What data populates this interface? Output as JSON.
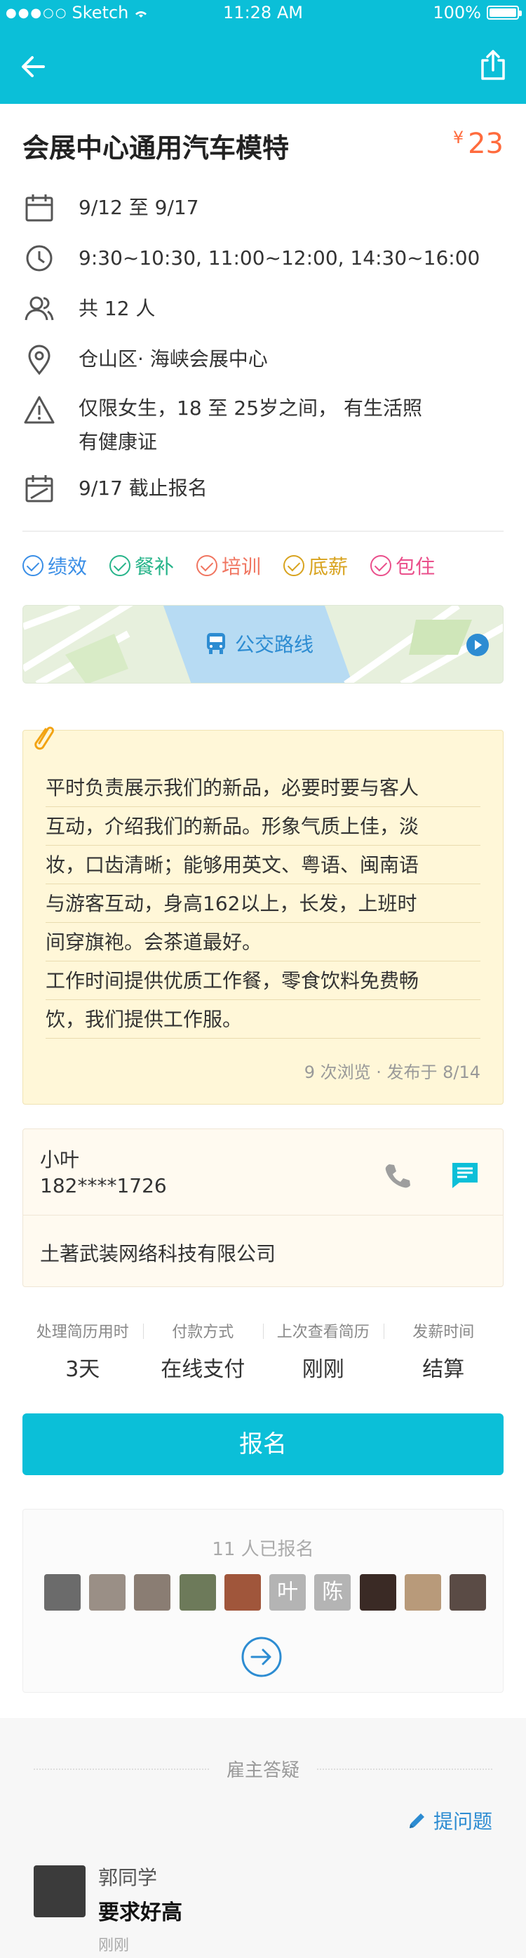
{
  "status_bar": {
    "carrier": "Sketch",
    "time": "11:28 AM",
    "battery": "100%"
  },
  "job": {
    "title": "会展中心通用汽车模特",
    "price_symbol": "¥",
    "price": "23"
  },
  "info": {
    "date": "9/12 至 9/17",
    "time": "9:30~10:30, 11:00~12:00, 14:30~16:00",
    "headcount": "共 12 人",
    "location": "仓山区· 海峡会展中心",
    "requirement_line1": "仅限女生，18 至 25岁之间， 有生活照",
    "requirement_line2": "有健康证",
    "deadline": "9/17 截止报名"
  },
  "tags": [
    {
      "label": "绩效",
      "color": "#3a8ee6"
    },
    {
      "label": "餐补",
      "color": "#27b48a"
    },
    {
      "label": "培训",
      "color": "#f07560"
    },
    {
      "label": "底薪",
      "color": "#d8a31f"
    },
    {
      "label": "包住",
      "color": "#ea4f8b"
    }
  ],
  "map": {
    "label": "公交路线"
  },
  "description": {
    "lines": [
      "平时负责展示我们的新品，必要时要与客人",
      "互动，介绍我们的新品。形象气质上佳，淡",
      "妆，口齿清晰；能够用英文、粤语、闽南语",
      "与游客互动，身高162以上，长发，上班时",
      "间穿旗袍。会茶道最好。",
      "工作时间提供优质工作餐，零食饮料免费畅",
      "饮，我们提供工作服。"
    ],
    "meta": "9 次浏览 · 发布于 8/14"
  },
  "contact": {
    "name": "小叶",
    "phone": "182****1726",
    "company": "土著武装网络科技有限公司"
  },
  "stats": [
    {
      "label": "处理简历用时",
      "value": "3天"
    },
    {
      "label": "付款方式",
      "value": "在线支付"
    },
    {
      "label": "上次查看简历",
      "value": "刚刚"
    },
    {
      "label": "发薪时间",
      "value": "结算"
    }
  ],
  "apply_label": "报名",
  "applicants": {
    "count": "11 人已报名",
    "avatars": [
      "",
      "",
      "",
      "",
      "",
      "叶",
      "陈",
      "",
      "",
      ""
    ]
  },
  "qa": {
    "title": "雇主答疑",
    "ask_label": "提问题",
    "items": [
      {
        "name": "郭同学",
        "question": "要求好高",
        "time": "刚刚"
      }
    ]
  },
  "colors": {
    "primary": "#0bbfd8",
    "price": "#ff6b3d",
    "link": "#2d8cd2",
    "note_bg": "#fff7d8"
  }
}
